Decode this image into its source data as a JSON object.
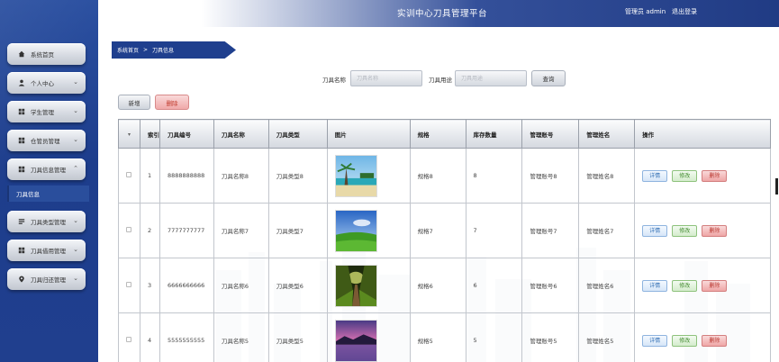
{
  "header": {
    "title": "实训中心刀具管理平台",
    "user_label": "管理员 admin",
    "logout_label": "退出登录",
    "gradient_colors": [
      "#ffffff",
      "#34509a",
      "#203b84"
    ]
  },
  "sidebar": {
    "background": "#1d3d8c",
    "items": [
      {
        "label": "系统首页",
        "icon": "home-icon",
        "has_chevron": false
      },
      {
        "label": "个人中心",
        "icon": "user-icon",
        "has_chevron": true
      },
      {
        "label": "学生管理",
        "icon": "grid-icon",
        "has_chevron": true
      },
      {
        "label": "仓管员管理",
        "icon": "grid-icon",
        "has_chevron": true
      },
      {
        "label": "刀具信息管理",
        "icon": "grid-icon",
        "has_chevron": true,
        "expanded": true
      },
      {
        "label": "刀具类型管理",
        "icon": "list-icon",
        "has_chevron": true
      },
      {
        "label": "刀具借用管理",
        "icon": "grid-icon",
        "has_chevron": true
      },
      {
        "label": "刀具归还管理",
        "icon": "pin-icon",
        "has_chevron": true
      }
    ],
    "submenu": {
      "label": "刀具信息"
    }
  },
  "breadcrumb": {
    "home": "系统首页",
    "separator": ">",
    "current": "刀具信息"
  },
  "search": {
    "name_label": "刀具名称",
    "name_placeholder": "刀具名称",
    "usage_label": "刀具用途",
    "usage_placeholder": "刀具用途",
    "query_label": "查询"
  },
  "toolbar": {
    "add_label": "新增",
    "delete_label": "删除"
  },
  "table": {
    "columns": [
      "",
      "索引",
      "刀具编号",
      "刀具名称",
      "刀具类型",
      "图片",
      "规格",
      "库存数量",
      "管理账号",
      "管理姓名",
      "操作"
    ],
    "rows": [
      {
        "index": "1",
        "code": "8888888888",
        "name": "刀具名称8",
        "type": "刀具类型8",
        "image": "beach-photo",
        "spec": "规格8",
        "stock": "8",
        "account": "管理账号8",
        "manager": "管理姓名8"
      },
      {
        "index": "2",
        "code": "7777777777",
        "name": "刀具名称7",
        "type": "刀具类型7",
        "image": "meadow-photo",
        "spec": "规格7",
        "stock": "7",
        "account": "管理账号7",
        "manager": "管理姓名7"
      },
      {
        "index": "3",
        "code": "6666666666",
        "name": "刀具名称6",
        "type": "刀具类型6",
        "image": "forest-road-photo",
        "spec": "规格6",
        "stock": "6",
        "account": "管理账号6",
        "manager": "管理姓名6"
      },
      {
        "index": "4",
        "code": "5555555555",
        "name": "刀具名称5",
        "type": "刀具类型5",
        "image": "sunset-lake-photo",
        "spec": "规格5",
        "stock": "5",
        "account": "管理账号5",
        "manager": "管理姓名5"
      }
    ],
    "actions": {
      "detail": "详情",
      "edit": "修改",
      "delete": "删除"
    }
  }
}
